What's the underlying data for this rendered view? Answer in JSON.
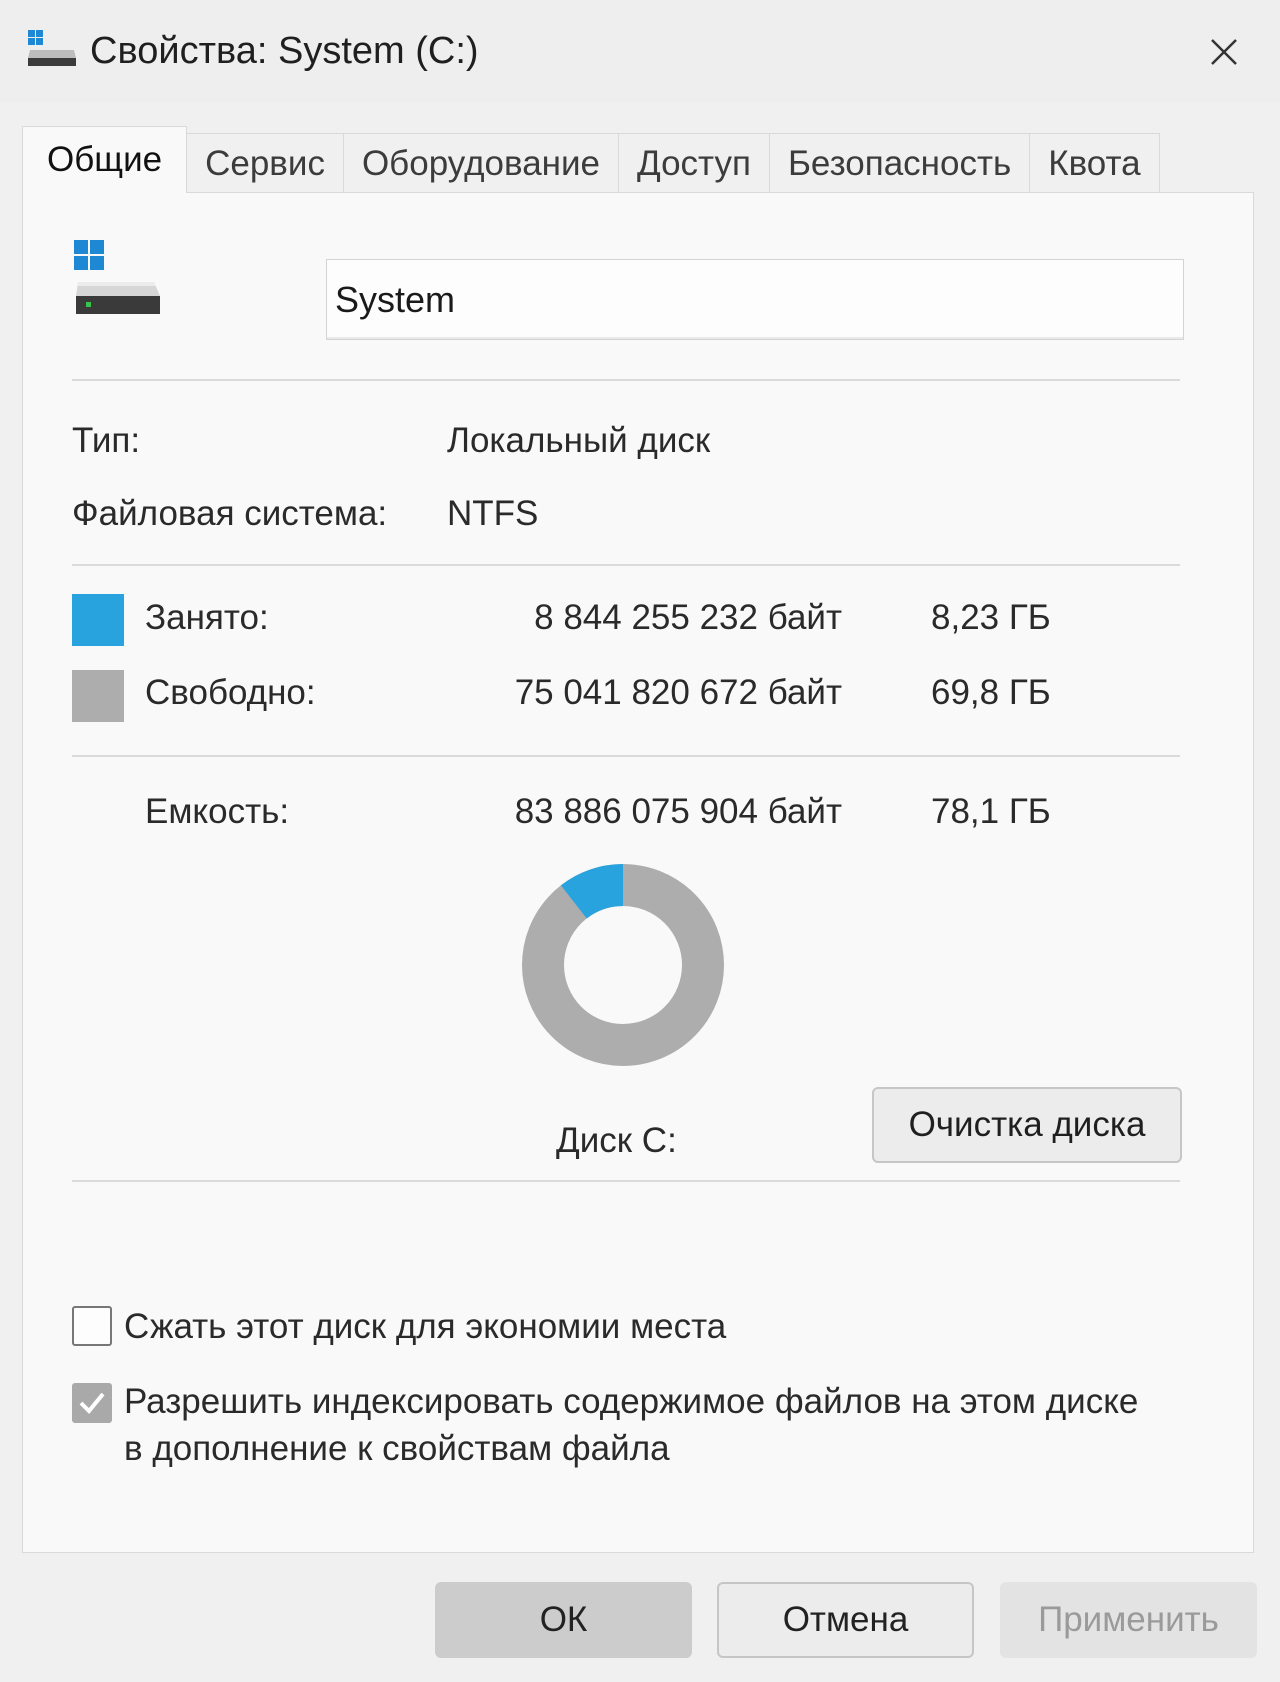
{
  "window": {
    "title": "Свойства: System (C:)",
    "close_glyph": "✕"
  },
  "tabs": [
    {
      "label": "Общие",
      "active": true
    },
    {
      "label": "Сервис",
      "active": false
    },
    {
      "label": "Оборудование",
      "active": false
    },
    {
      "label": "Доступ",
      "active": false
    },
    {
      "label": "Безопасность",
      "active": false
    },
    {
      "label": "Квота",
      "active": false
    }
  ],
  "general": {
    "drive_name": "System",
    "type_label": "Тип:",
    "type_value": "Локальный диск",
    "fs_label": "Файловая система:",
    "fs_value": "NTFS",
    "used": {
      "label": "Занято:",
      "bytes": "8 844 255 232 байт",
      "size": "8,23 ГБ",
      "color": "#29a3dd"
    },
    "free": {
      "label": "Свободно:",
      "bytes": "75 041 820 672 байт",
      "size": "69,8 ГБ",
      "color": "#adadad"
    },
    "capacity": {
      "label": "Емкость:",
      "bytes": "83 886 075 904 байт",
      "size": "78,1 ГБ"
    },
    "disk_label": "Диск C:",
    "cleanup_button": "Очистка диска",
    "compress_checkbox": {
      "label": "Сжать этот диск для экономии места",
      "checked": false
    },
    "index_checkbox": {
      "label": "Разрешить индексировать содержимое файлов на этом диске в дополнение к свойствам файла",
      "checked": true
    }
  },
  "usage_fraction": {
    "used": 0.1054,
    "free": 0.8946
  },
  "buttons": {
    "ok": "ОК",
    "cancel": "Отмена",
    "apply": "Применить"
  },
  "icons": [
    "drive-icon",
    "windows-logo-icon",
    "close-icon",
    "check-icon"
  ]
}
